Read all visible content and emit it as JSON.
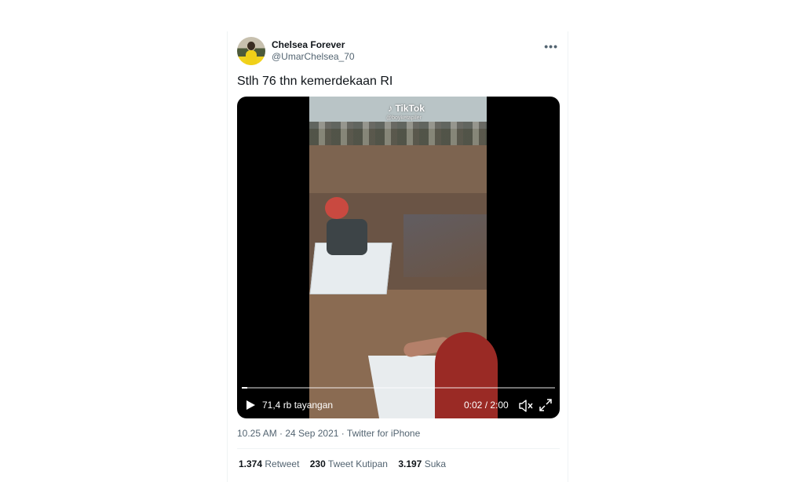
{
  "tweet": {
    "display_name": "Chelsea Forever",
    "handle": "@UmarChelsea_70",
    "more_icon": "more-horizontal-icon",
    "text": "Stlh 76 thn kemerdekaan RI",
    "media": {
      "watermark_logo": "TikTok",
      "watermark_handle": "@boyketapiler",
      "views": "71,4 rb tayangan",
      "timecode": "0:02 / 2:00",
      "progress_fraction": 0.017,
      "play_icon": "play-icon",
      "mute_icon": "volume-muted-icon",
      "fullscreen_icon": "fullscreen-icon"
    },
    "timestamp": "10.25 AM · 24 Sep 2021",
    "source": "Twitter for iPhone",
    "stats": {
      "retweets": "1.374",
      "retweets_label": "Retweet",
      "quotes": "230",
      "quotes_label": "Tweet Kutipan",
      "likes": "3.197",
      "likes_label": "Suka"
    }
  }
}
